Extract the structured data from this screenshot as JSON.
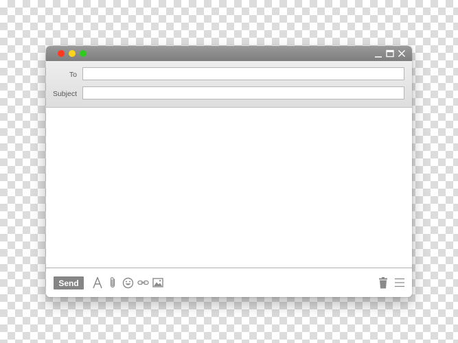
{
  "window": {
    "traffic_lights": {
      "close": "#ff3b1f",
      "minimize": "#ffd41c",
      "zoom": "#2ecc1f"
    },
    "controls": [
      "minimize-icon",
      "maximize-icon",
      "close-icon"
    ]
  },
  "compose": {
    "to": {
      "label": "To",
      "value": "",
      "placeholder": ""
    },
    "subject": {
      "label": "Subject",
      "value": "",
      "placeholder": ""
    },
    "body": ""
  },
  "toolbar": {
    "send_label": "Send",
    "tools": [
      "font-icon",
      "paperclip-icon",
      "emoji-icon",
      "link-icon",
      "image-icon"
    ],
    "right_tools": [
      "trash-icon",
      "menu-icon"
    ]
  },
  "colors": {
    "titlebar": "#8a8a8a",
    "send_button": "#858585",
    "icon": "#8a8a8a"
  }
}
